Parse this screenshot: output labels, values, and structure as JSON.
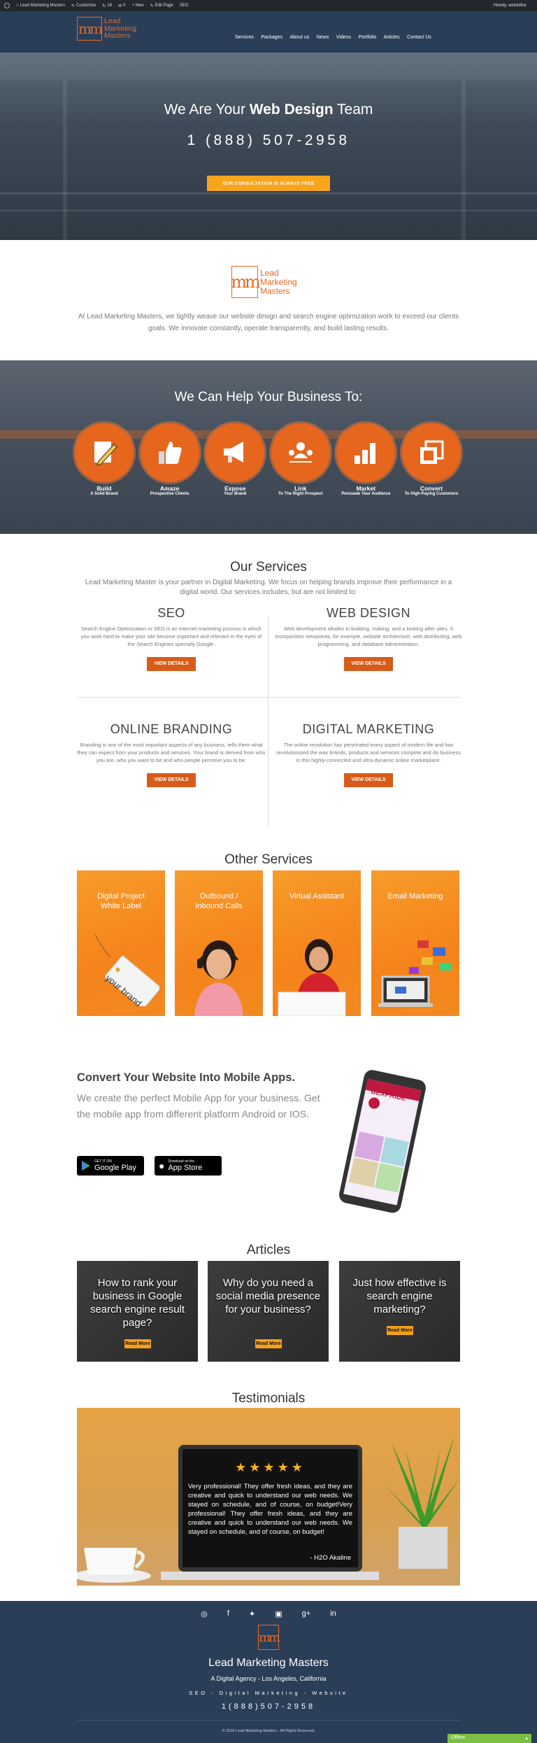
{
  "adminbar": {
    "items": [
      "Lead Marketing Masters",
      "Customize",
      "18",
      "0",
      "+ New",
      "Edit Page",
      "SEO"
    ],
    "greeting": "Howdy, webeditor"
  },
  "brand": {
    "line1": "Lead",
    "line2": "Marketing",
    "line3": "Masters",
    "mark": "mm",
    "accent": "#e8691e",
    "navy": "#2b3e58"
  },
  "nav": [
    "Services",
    "Packages",
    "About us",
    "News",
    "Videos",
    "Portfolio",
    "Articles",
    "Contact Us"
  ],
  "hero": {
    "title_pre": "We Are Your ",
    "title_bold": "Web Design",
    "title_post": " Team",
    "phone": "1 (888) 507-2958",
    "cta": "OUR CONSULTATION IS ALWAYS FREE"
  },
  "intro": {
    "text": "At Lead Marketing Masters, we tightly weave our website design and search engine optimization work to exceed our clients goals. We innovate constantly, operate transparently, and build lasting results."
  },
  "help": {
    "title": "We Can Help Your Business To:",
    "items": [
      {
        "title": "Build",
        "sub": "A Solid Brand",
        "icon": "pencil-paper-icon"
      },
      {
        "title": "Amaze",
        "sub": "Prospective Clients",
        "icon": "thumbs-up-icon"
      },
      {
        "title": "Expose",
        "sub": "Your Brand",
        "icon": "megaphone-icon"
      },
      {
        "title": "Link",
        "sub": "To The Right Prospect",
        "icon": "people-network-icon"
      },
      {
        "title": "Market",
        "sub": "Persuade Your Audience",
        "icon": "bar-chart-icon"
      },
      {
        "title": "Convert",
        "sub": "To High-Paying Customers",
        "icon": "convert-icon"
      }
    ]
  },
  "services": {
    "title": "Our Services",
    "subtitle": "Lead Marketing Master is your partner in Digital Marketing. We focus on helping brands improve their performance in a digital world. Our services includes, but are not limited to:",
    "button": "VIEW DETAILS",
    "items": [
      {
        "title": "SEO",
        "text": "Search Engine Optimization or SEO is an Internet marketing process in which you work hard to make your site become important and relevant in the eyes of the Search Engines specially Google."
      },
      {
        "title": "WEB DESIGN",
        "text": "Web development alludes in building, making, and a looking after sites. It incorporates viewpoints, for example, website architecture, web distributing, web programming, and database administration."
      },
      {
        "title": "ONLINE BRANDING",
        "text": "Branding is one of the most important aspects of any business, tells them what they can expect from your products and services. Your brand is derived from who you are, who you want to be and who people perceive you to be."
      },
      {
        "title": "DIGITAL MARKETING",
        "text": "The online revolution has penetrated every aspect of modern life and has revolutionized the way brands, products and services compete and do business in this highly-connected and ultra-dynamic online marketplace."
      }
    ]
  },
  "other": {
    "title": "Other Services",
    "items": [
      {
        "title": "Digital Project White Label",
        "tag": "your brand"
      },
      {
        "title": "Outbound / Inbound Calls"
      },
      {
        "title": "Virtual Assistant"
      },
      {
        "title": "Email Marketing"
      }
    ]
  },
  "mobile": {
    "title": "Convert Your Website Into Mobile Apps.",
    "text": "We create the perfect Mobile App for your business. Get the mobile app from different platform Android or IOS.",
    "google_small": "GET IT ON",
    "google_big": "Google Play",
    "apple_small": "Download on the",
    "apple_big": "App Store",
    "phone_brand": "BEXPRIDE"
  },
  "articles": {
    "title": "Articles",
    "button": "Read More",
    "items": [
      {
        "title": "How to rank your business in Google search engine result page?"
      },
      {
        "title": "Why do you need a social media presence for your business?"
      },
      {
        "title": "Just how effective is search engine marketing?"
      }
    ]
  },
  "testimonials": {
    "title": "Testimonials",
    "stars": "★★★★★",
    "quote": "Very professional! They offer fresh ideas, and they are creative and quick to understand our web needs. We stayed on schedule, and of course, on budget!Very professional! They offer fresh ideas, and they are creative and quick to understand our web needs. We stayed on schedule, and of course, on budget!",
    "author": "- H2O Akaline"
  },
  "footer": {
    "socials": [
      "instagram-icon",
      "facebook-icon",
      "twitter-icon",
      "instagram-icon",
      "google-plus-icon",
      "linkedin-icon"
    ],
    "name": "Lead Marketing Masters",
    "tagline": "A Digital Agency - Los Angeles, California",
    "services": "SEO - Digital Marketing - Website",
    "phone": "1(888)507-2958",
    "copyright": "© 2018 Lead Marketing Masters - All Rights Reserved.",
    "chat": "Offline"
  }
}
